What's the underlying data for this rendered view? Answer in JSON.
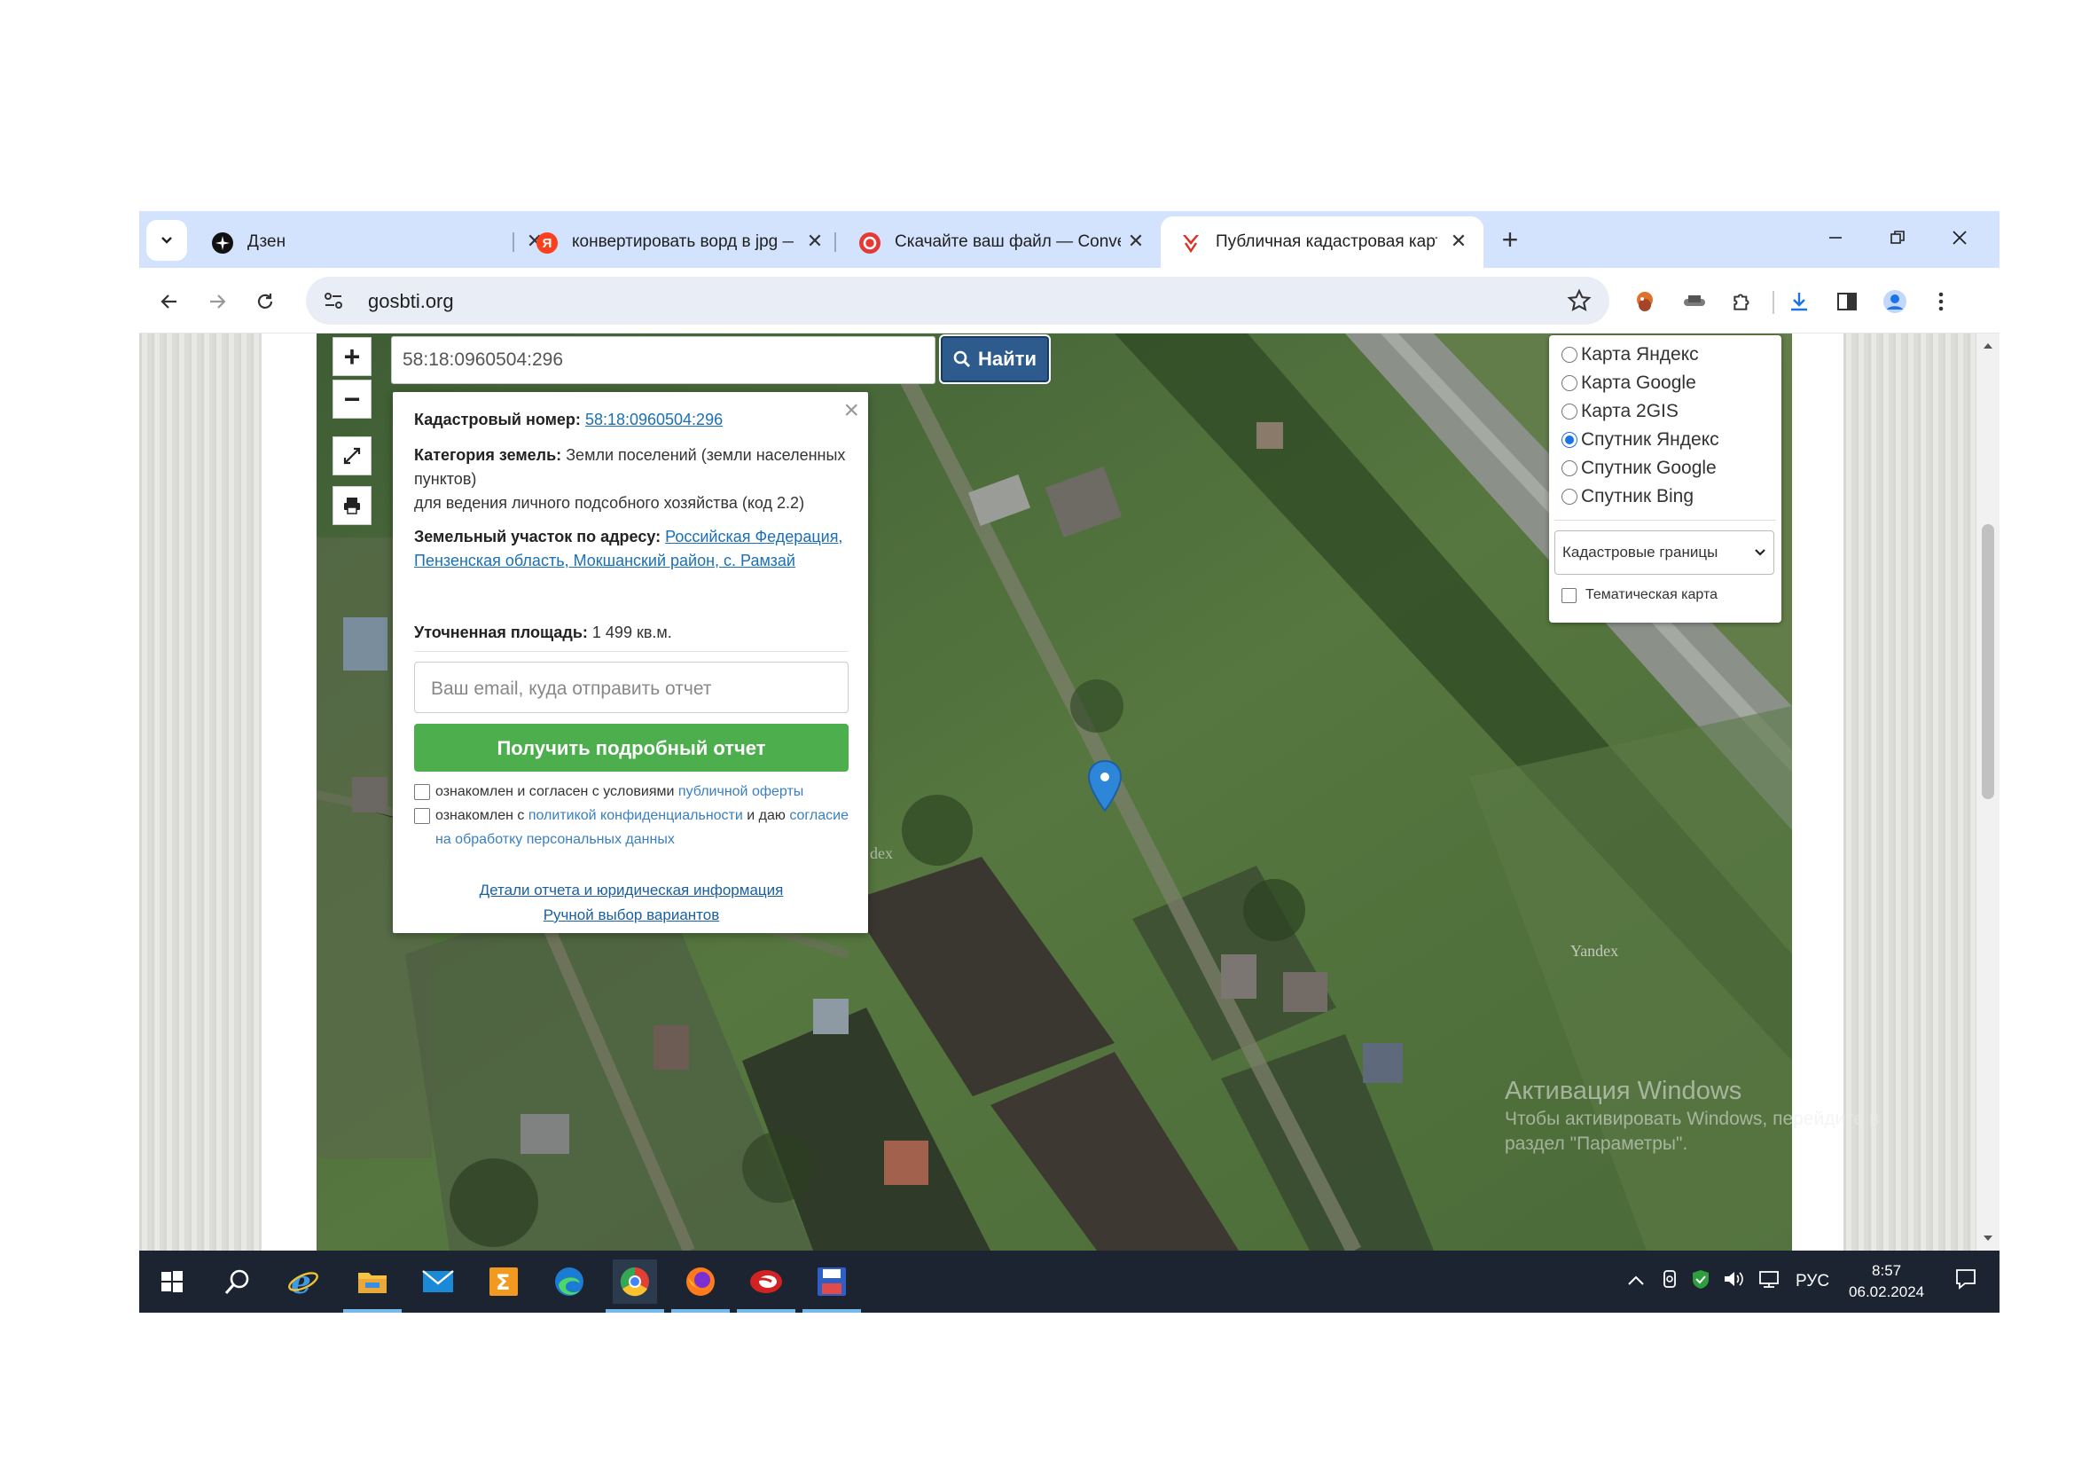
{
  "browser": {
    "tabs": [
      {
        "title": "Дзен",
        "active": false
      },
      {
        "title": "конвертировать ворд в jpg — Яндекс",
        "active": false
      },
      {
        "title": "Скачайте ваш файл — Convertio",
        "active": false
      },
      {
        "title": "Публичная кадастровая карта",
        "active": true
      }
    ],
    "address": "gosbti.org"
  },
  "map": {
    "search_value": "58:18:0960504:296",
    "find_label": "Найти",
    "zoom_in": "+",
    "zoom_out": "−",
    "popup": {
      "cad_label": "Кадастровый номер:",
      "cad_value": "58:18:0960504:296",
      "cat_label": "Категория земель:",
      "cat_value": "Земли поселений (земли населенных пунктов)",
      "use_value": "для ведения личного подсобного хозяйства (код 2.2)",
      "addr_label": "Земельный участок по адресу:",
      "addr_value": "Российская Федерация, Пензенская область, Мокшанский район, с. Рамзай",
      "area_label": "Уточненная площадь:",
      "area_value": "1 499 кв.м.",
      "email_placeholder": "Ваш email, куда отправить отчет",
      "report_button": "Получить подробный отчет",
      "consent1_text": "ознакомлен и согласен с условиями",
      "consent1_link": "публичной оферты",
      "consent2_text": "ознакомлен с",
      "consent2_link": "политикой конфиденциальности",
      "consent2_text2": "и даю",
      "consent2_link2": "согласие на обработку персональных данных",
      "link_details": "Детали отчета и юридическая информация",
      "link_manual": "Ручной выбор вариантов"
    },
    "layers": {
      "options": [
        "Карта Яндекс",
        "Карта Google",
        "Карта 2GIS",
        "Спутник Яндекс",
        "Спутник Google",
        "Спутник Bing"
      ],
      "selected": "Спутник Яндекс",
      "overlay_select": "Кадастровые границы",
      "thematic": "Тематическая карта"
    },
    "watermark_yandex": "Yandex",
    "watermark_yandex2": "dex"
  },
  "activation": {
    "title": "Активация Windows",
    "line1": "Чтобы активировать Windows, перейдите в",
    "line2": "раздел \"Параметры\"."
  },
  "taskbar": {
    "lang": "РУС",
    "time": "8:57",
    "date": "06.02.2024"
  },
  "colors": {
    "tabbar": "#d3e3fd",
    "find_button": "#2d5b8e",
    "report_button": "#4cae4c",
    "link": "#1a6fb5",
    "taskbar": "#1b2430"
  }
}
